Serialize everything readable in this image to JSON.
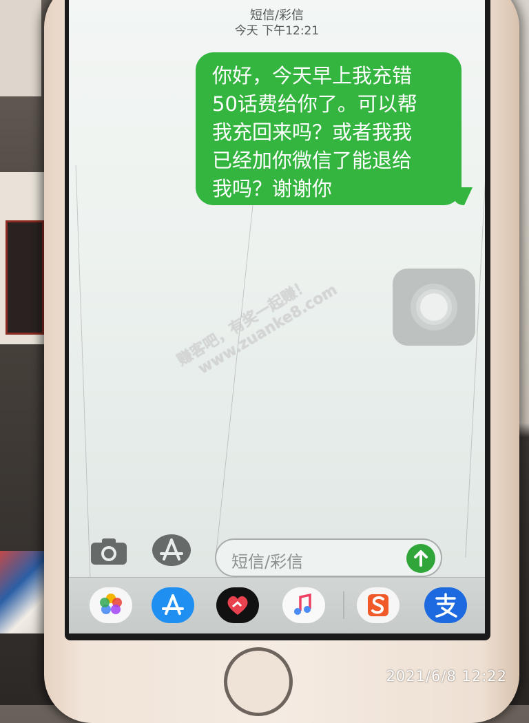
{
  "messages": {
    "header_title": "短信/彩信",
    "header_time": "今天 下午12:21",
    "bubble": {
      "color": "#34b53f",
      "lines": [
        "你好，今天早上我充错",
        "50话费给你了。可以帮",
        "我充回来吗？或者我我",
        "已经加你微信了能退给",
        "我吗？谢谢你"
      ]
    },
    "input": {
      "placeholder": "短信/彩信"
    },
    "toolbar_icons": [
      "camera-icon",
      "app-store-icon",
      "send-arrow-icon"
    ]
  },
  "dock": {
    "apps": [
      "photos-icon",
      "app-store-icon",
      "heart-app-icon",
      "music-icon",
      "sogou-icon",
      "alipay-icon"
    ]
  },
  "watermark": {
    "line1": "赚客吧，有奖一起赚！",
    "line2": "www.zuanke8.com"
  },
  "photo_timestamp": "2021/6/8  12:22"
}
